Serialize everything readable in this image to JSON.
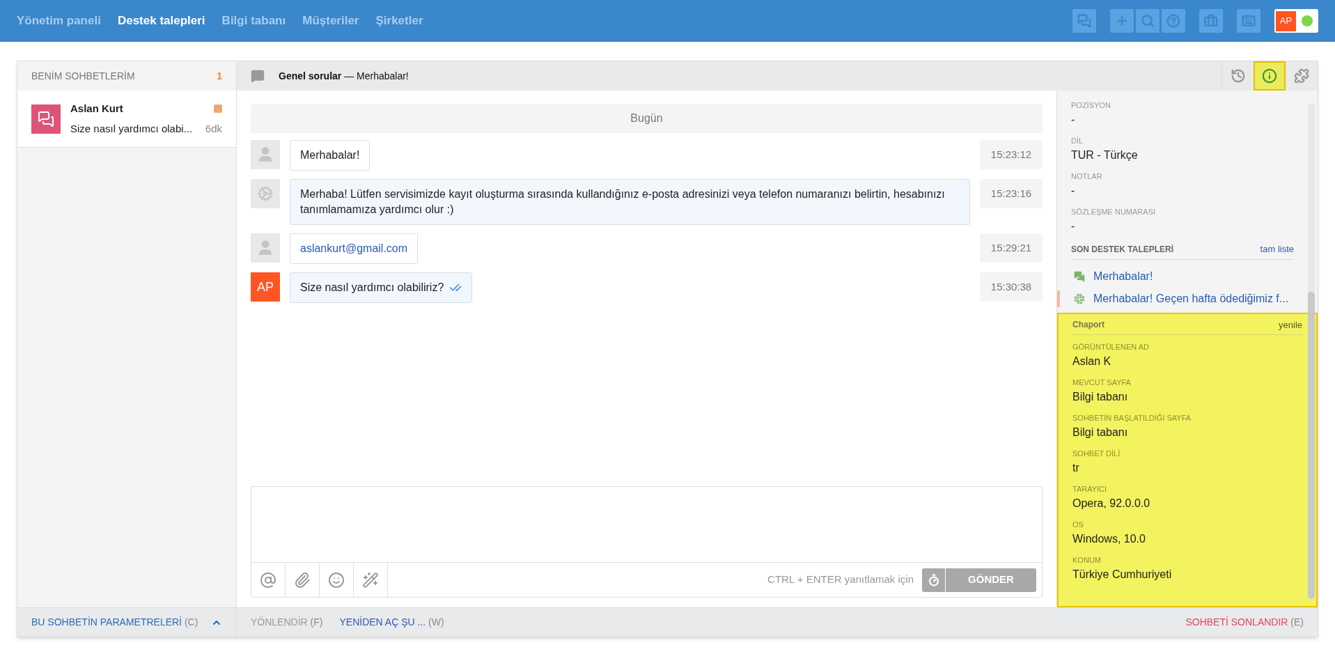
{
  "nav": [
    {
      "label": "Yönetim paneli",
      "selected": false
    },
    {
      "label": "Destek talepleri",
      "selected": true
    },
    {
      "label": "Bilgi tabanı",
      "selected": false
    },
    {
      "label": "Müşteriler",
      "selected": false
    },
    {
      "label": "Şirketler",
      "selected": false
    }
  ],
  "user_badge": {
    "initials": "AP",
    "online": true
  },
  "sidebar": {
    "title": "BENİM SOHBETLERİM",
    "count": "1",
    "chats": [
      {
        "name": "Aslan Kurt",
        "preview": "Size nasıl yardımcı olabi...",
        "time": "6dk",
        "color": "#f0a86e",
        "selected": true
      }
    ],
    "footer": {
      "label": "BU SOHBETİN PARAMETRELERİ",
      "shortcut": "(C)"
    }
  },
  "conversation": {
    "topic": "Genel sorular",
    "dash": "—",
    "subject": "Merhabalar!",
    "date_divider": "Bugün",
    "messages": [
      {
        "kind": "user",
        "text": "Merhabalar!",
        "time": "15:23:12",
        "link": false,
        "read": false
      },
      {
        "kind": "bot",
        "text": "Merhaba! Lütfen servisimizde kayıt oluşturma sırasında kullandığınız e-posta adresinizi veya telefon numaranızı belirtin, hesabınızı tanımlamamıza yardımcı olur :)",
        "time": "15:23:16",
        "link": false,
        "read": false
      },
      {
        "kind": "user",
        "text": "aslankurt@gmail.com",
        "time": "15:29:21",
        "link": true,
        "read": false
      },
      {
        "kind": "agent",
        "initials": "AP",
        "text": "Size nasıl yardımcı olabiliriz?",
        "time": "15:30:38",
        "link": false,
        "read": true
      }
    ],
    "composer": {
      "hint": "CTRL + ENTER yanıtlamak için",
      "send": "GÖNDER"
    },
    "actions": [
      {
        "label": "YÖNLENDİR",
        "shortcut": "(F)",
        "kind": "muted"
      },
      {
        "label": "YENİDEN AÇ ŞU ...",
        "shortcut": "(W)",
        "kind": "link"
      },
      {
        "label": "SOHBETİ SONLANDIR",
        "shortcut": "(E)",
        "kind": "danger"
      }
    ]
  },
  "panel": {
    "tabs": [
      {
        "kind": "history",
        "selected": false
      },
      {
        "kind": "info",
        "selected": true
      },
      {
        "kind": "plugin",
        "selected": false
      }
    ],
    "fields": [
      {
        "label": "POZİSYON",
        "value": "-"
      },
      {
        "label": "DİL",
        "value": "TUR - Türkçe"
      },
      {
        "label": "NOTLAR",
        "value": "-"
      },
      {
        "label": "SÖZLEŞME NUMARASI",
        "value": "-"
      }
    ],
    "recent": {
      "title": "SON DESTEK TALEPLERİ",
      "link": "tam liste",
      "items": [
        {
          "kind": "chat",
          "text": "Merhabalar!",
          "flagged": false
        },
        {
          "kind": "slack",
          "text": "Merhabalar! Geçen hafta ödediğimiz f...",
          "flagged": true
        }
      ]
    },
    "integration": {
      "title": "Chaport",
      "action": "yenile",
      "fields": [
        {
          "label": "GÖRÜNTÜLENEN AD",
          "value": "Aslan K"
        },
        {
          "label": "MEVCUT SAYFA",
          "value": "Bilgi tabanı"
        },
        {
          "label": "SOHBETİN BAŞLATILDIĞI SAYFA",
          "value": "Bilgi tabanı"
        },
        {
          "label": "SOHBET DİLİ",
          "value": "tr"
        },
        {
          "label": "TARAYICI",
          "value": "Opera, 92.0.0.0"
        },
        {
          "label": "OS",
          "value": "Windows, 10.0"
        },
        {
          "label": "KONUM",
          "value": "Türkiye Cumhuriyeti"
        }
      ]
    }
  }
}
